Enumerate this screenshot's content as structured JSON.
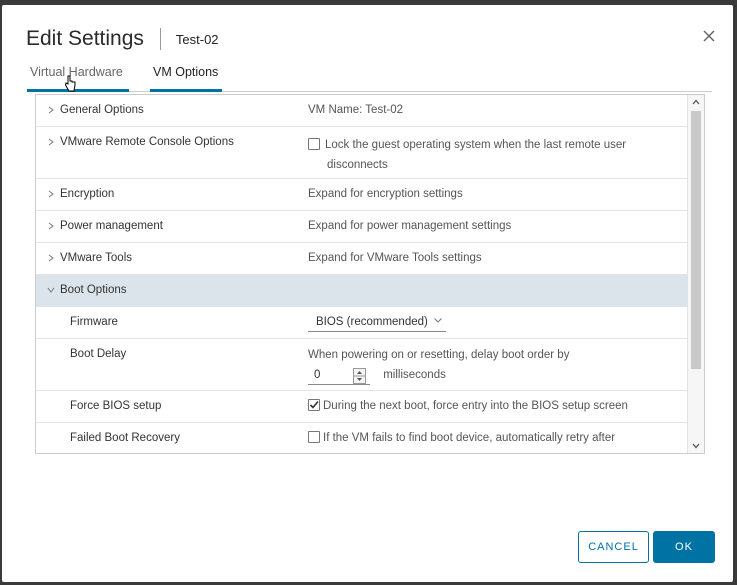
{
  "dialog": {
    "title": "Edit Settings",
    "subtitle": "Test-02",
    "close_icon": "close-icon"
  },
  "tabs": [
    {
      "label": "Virtual Hardware",
      "active": false
    },
    {
      "label": "VM Options",
      "active": true
    }
  ],
  "rows": {
    "general": {
      "label": "General Options",
      "value": "VM Name: Test-02"
    },
    "vmrc": {
      "label": "VMware Remote Console Options",
      "value_line1": "Lock the guest operating system when the last remote user",
      "value_line2": "disconnects",
      "checked": false
    },
    "encryption": {
      "label": "Encryption",
      "value": "Expand for encryption settings"
    },
    "power": {
      "label": "Power management",
      "value": "Expand for power management settings"
    },
    "tools": {
      "label": "VMware Tools",
      "value": "Expand for VMware Tools settings"
    },
    "boot": {
      "label": "Boot Options",
      "expanded": true
    },
    "firmware": {
      "label": "Firmware",
      "value": "BIOS (recommended)"
    },
    "boot_delay": {
      "label": "Boot Delay",
      "text": "When powering on or resetting, delay boot order by",
      "number": "0",
      "unit": "milliseconds"
    },
    "force_bios": {
      "label": "Force BIOS setup",
      "value": "During the next boot, force entry into the BIOS setup screen",
      "checked": true
    },
    "failed_boot": {
      "label": "Failed Boot Recovery",
      "value": "If the VM fails to find boot device, automatically retry after",
      "checked": false
    }
  },
  "buttons": {
    "cancel": "CANCEL",
    "ok": "OK"
  },
  "colors": {
    "accent": "#0072a3",
    "highlight_row": "#dae4ea"
  }
}
